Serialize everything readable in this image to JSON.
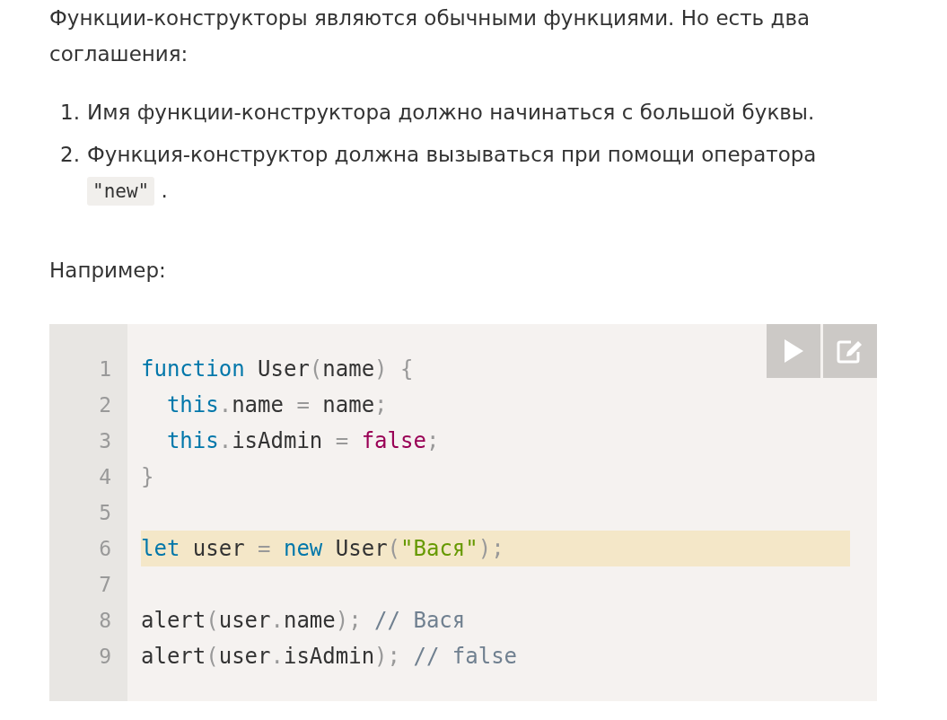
{
  "intro": "Функции-конструкторы являются обычными функциями. Но есть два соглашения:",
  "conventions": [
    {
      "number": "1.",
      "text": "Имя функции-конструктора должно начинаться с большой буквы."
    },
    {
      "number": "2.",
      "text": "Функция-конструктор должна вызываться при помощи оператора",
      "code": "\"new\"",
      "after": "."
    }
  ],
  "example_label": "Например:",
  "code": {
    "lines": [
      {
        "number": "1",
        "highlighted": false,
        "tokens": [
          {
            "kind": "keyword",
            "text": "function"
          },
          {
            "kind": "plain",
            "text": " User"
          },
          {
            "kind": "punct",
            "text": "("
          },
          {
            "kind": "plain",
            "text": "name"
          },
          {
            "kind": "punct",
            "text": ") {"
          }
        ]
      },
      {
        "number": "2",
        "highlighted": false,
        "tokens": [
          {
            "kind": "keyword",
            "text": "  this"
          },
          {
            "kind": "punct",
            "text": "."
          },
          {
            "kind": "plain",
            "text": "name "
          },
          {
            "kind": "punct",
            "text": "="
          },
          {
            "kind": "plain",
            "text": " name"
          },
          {
            "kind": "punct",
            "text": ";"
          }
        ]
      },
      {
        "number": "3",
        "highlighted": false,
        "tokens": [
          {
            "kind": "keyword",
            "text": "  this"
          },
          {
            "kind": "punct",
            "text": "."
          },
          {
            "kind": "plain",
            "text": "isAdmin "
          },
          {
            "kind": "punct",
            "text": "= "
          },
          {
            "kind": "boolean",
            "text": "false"
          },
          {
            "kind": "punct",
            "text": ";"
          }
        ]
      },
      {
        "number": "4",
        "highlighted": false,
        "tokens": [
          {
            "kind": "punct",
            "text": "}"
          }
        ]
      },
      {
        "number": "5"
      },
      {
        "number": "6",
        "highlighted": true,
        "tokens": [
          {
            "kind": "keyword",
            "text": "let"
          },
          {
            "kind": "plain",
            "text": " user "
          },
          {
            "kind": "punct",
            "text": "= "
          },
          {
            "kind": "keyword",
            "text": "new"
          },
          {
            "kind": "plain",
            "text": " User"
          },
          {
            "kind": "punct",
            "text": "("
          },
          {
            "kind": "string",
            "text": "\"Вася\""
          },
          {
            "kind": "punct",
            "text": ");"
          }
        ]
      },
      {
        "number": "7"
      },
      {
        "number": "8",
        "highlighted": false,
        "tokens": [
          {
            "kind": "plain",
            "text": "alert"
          },
          {
            "kind": "punct",
            "text": "("
          },
          {
            "kind": "plain",
            "text": "user"
          },
          {
            "kind": "punct",
            "text": "."
          },
          {
            "kind": "plain",
            "text": "name"
          },
          {
            "kind": "punct",
            "text": "); "
          },
          {
            "kind": "comment",
            "text": "// Вася"
          }
        ]
      },
      {
        "number": "9",
        "highlighted": false,
        "tokens": [
          {
            "kind": "plain",
            "text": "alert"
          },
          {
            "kind": "punct",
            "text": "("
          },
          {
            "kind": "plain",
            "text": "user"
          },
          {
            "kind": "punct",
            "text": "."
          },
          {
            "kind": "plain",
            "text": "isAdmin"
          },
          {
            "kind": "punct",
            "text": "); "
          },
          {
            "kind": "comment",
            "text": "// false"
          }
        ]
      }
    ]
  }
}
